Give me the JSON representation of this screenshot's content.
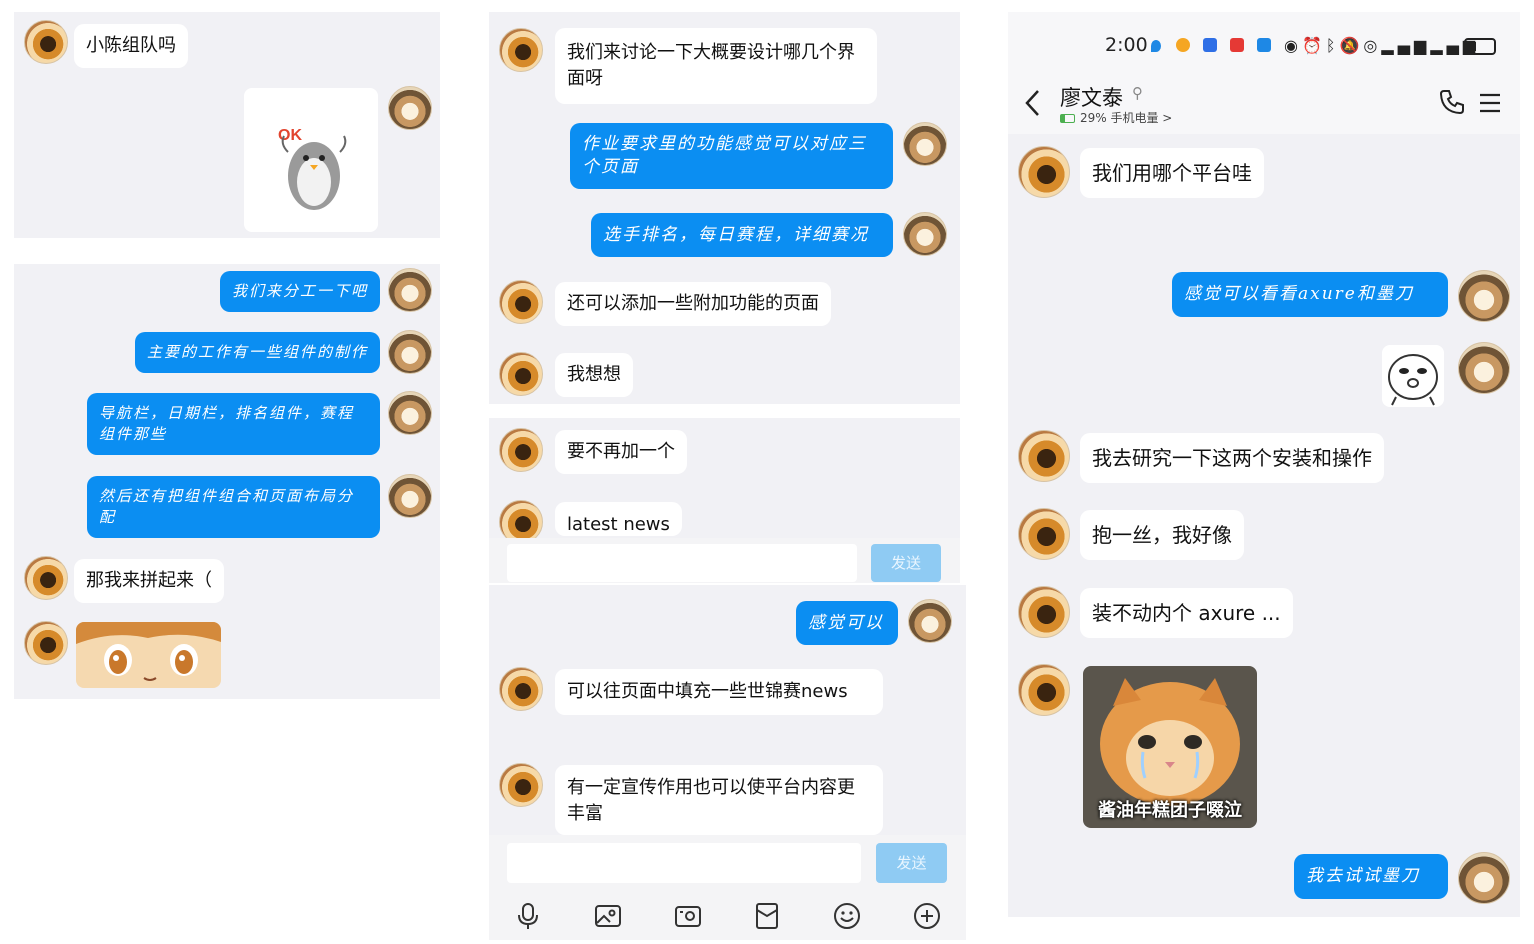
{
  "panel1": {
    "messages": [
      {
        "text": "小陈组队吗"
      },
      {
        "text": "我们来分工一下吧"
      },
      {
        "text": "主要的工作有一些组件的制作"
      },
      {
        "text": "导航栏，日期栏，排名组件，赛程组件那些"
      },
      {
        "text": "然后还有把组件组合和页面布局分配"
      },
      {
        "text": "那我来拼起来（"
      }
    ],
    "sticker_text": "OK"
  },
  "panel2": {
    "messages": [
      {
        "text": "我们来讨论一下大概要设计哪几个界面呀"
      },
      {
        "text": "作业要求里的功能感觉可以对应三个页面"
      },
      {
        "text": "选手排名，每日赛程，详细赛况"
      },
      {
        "text": "还可以添加一些附加功能的页面"
      },
      {
        "text": "我想想"
      },
      {
        "text": "要不再加一个"
      },
      {
        "text": "latest news"
      }
    ],
    "send_label": "发送"
  },
  "panel3": {
    "messages": [
      {
        "text": "感觉可以"
      },
      {
        "text": "可以往页面中填充一些世锦赛news"
      },
      {
        "text": "有一定宣传作用也可以使平台内容更丰富"
      }
    ],
    "send_label": "发送",
    "toolbar_icons": [
      "microphone-icon",
      "image-icon",
      "camera-icon",
      "red-packet-icon",
      "emoji-icon",
      "plus-icon"
    ]
  },
  "panel4": {
    "status_time": "2:00",
    "contact_name": "廖文泰",
    "battery_info": "29% 手机电量 >",
    "messages": [
      {
        "text": "我们用哪个平台哇"
      },
      {
        "text": "感觉可以看看axure和墨刀"
      },
      {
        "text": "我去研究一下这两个安装和操作"
      },
      {
        "text": "抱一丝，我好像"
      },
      {
        "text": "装不动内个 axure ..."
      },
      {
        "text": "我去试试墨刀"
      }
    ],
    "cat_caption": "酱油年糕团子啜泣",
    "status_icons": [
      "eye-icon",
      "alarm-icon",
      "bluetooth-icon",
      "mute-icon",
      "hotspot-icon",
      "signal-5g-icon",
      "signal-4g-icon",
      "battery-icon"
    ]
  },
  "colors": {
    "out_bubble": "#0b8ef2",
    "in_bubble": "#ffffff",
    "panel_bg": "#f1f1f5",
    "send_button": "#8fcbf3"
  }
}
